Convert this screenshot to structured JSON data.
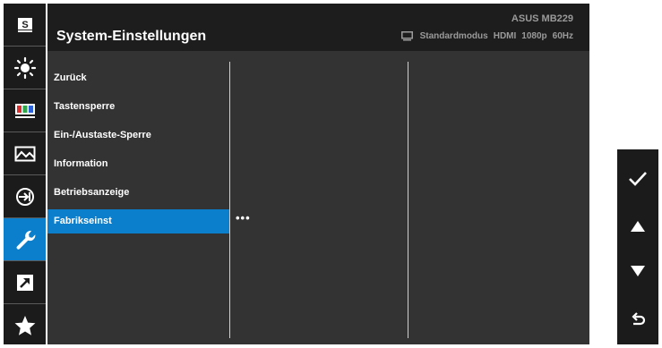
{
  "header": {
    "title": "System-Einstellungen",
    "model": "ASUS MB229",
    "status": {
      "mode": "Standardmodus",
      "input": "HDMI",
      "resolution": "1080p",
      "refresh": "60Hz"
    }
  },
  "sidebar": {
    "items": [
      {
        "icon": "splendid-s-icon",
        "label": "S"
      },
      {
        "icon": "brightness-icon"
      },
      {
        "icon": "color-bars-icon"
      },
      {
        "icon": "image-icon"
      },
      {
        "icon": "input-select-icon"
      },
      {
        "icon": "wrench-icon",
        "active": true
      },
      {
        "icon": "shortcut-arrow-icon"
      },
      {
        "icon": "star-icon"
      }
    ]
  },
  "menu": {
    "items": [
      "Zurück",
      "Tastensperre",
      "Ein-/Austaste-Sperre",
      "Information",
      "Betriebsanzeige",
      "Fabrikseinst"
    ],
    "selected_index": 5,
    "submenu_indicator": "•••"
  },
  "hardware_buttons": [
    {
      "icon": "checkmark-icon"
    },
    {
      "icon": "arrow-up-icon"
    },
    {
      "icon": "arrow-down-icon"
    },
    {
      "icon": "back-icon"
    }
  ],
  "colors": {
    "accent": "#0b7fcc",
    "panel": "#333333",
    "header": "#1d1d1d",
    "sidebar": "#1b1b1b"
  }
}
